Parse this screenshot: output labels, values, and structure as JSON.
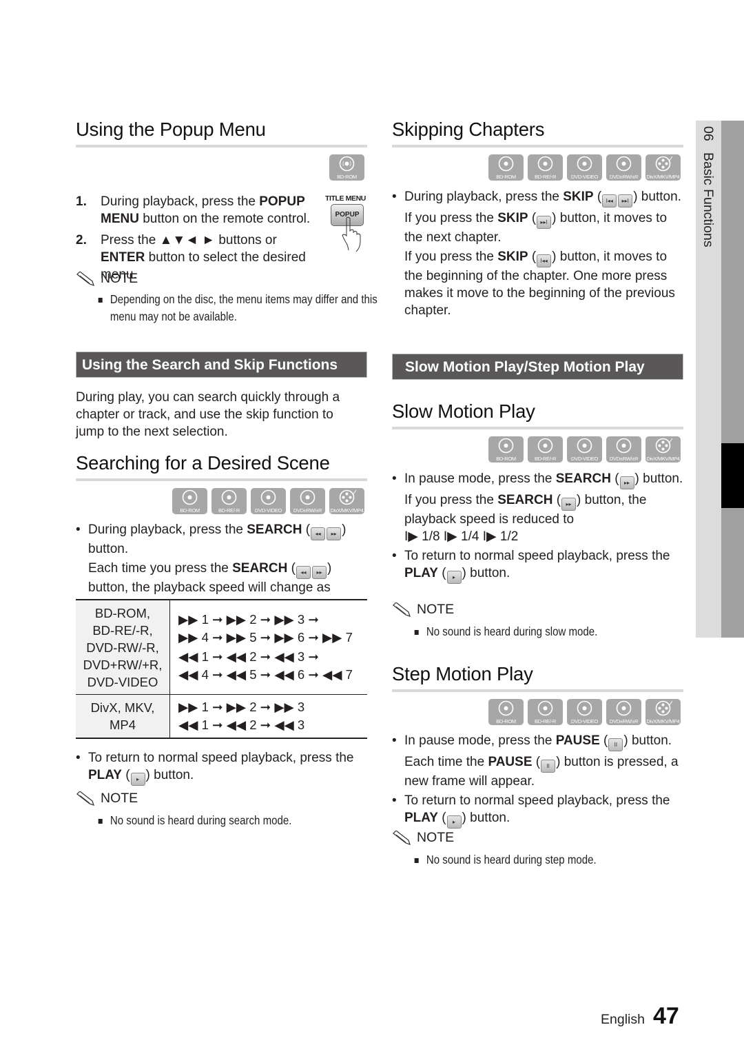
{
  "disc_badges": {
    "bd_rom": "BD-ROM",
    "bd_re": "BD-RE/-R",
    "dvd_video": "DVD-VIDEO",
    "dvd_rw": "DVD±RW/±R",
    "divx": "DivX/MKV/MP4"
  },
  "popup_menu": {
    "title": "Using the Popup Menu",
    "remote_label_top": "TITLE MENU",
    "remote_label_button": "POPUP",
    "steps": [
      {
        "num": "1.",
        "pre": "During playback, press the ",
        "bold": "POPUP MENU",
        "post": " button on the remote control."
      },
      {
        "num": "2.",
        "pre": "Press the ",
        "arrows": "▲▼◄ ►",
        "mid": " buttons or ",
        "bold": "ENTER",
        "post": " button to select the desired menu."
      }
    ],
    "note_label": "NOTE",
    "note_text": "Depending on the disc, the menu items may differ and this menu may not be available."
  },
  "search_skip": {
    "section_bar": "Using the Search and Skip Functions",
    "intro": "During play, you can search quickly through a chapter or track, and use the skip function to jump to the next selection."
  },
  "searching": {
    "title": "Searching for a Desired Scene",
    "bullet1_pre": "During playback, press the ",
    "bullet1_bold": "SEARCH",
    "bullet1_post": " button.",
    "sub_pre": "Each time you press the ",
    "sub_bold": "SEARCH",
    "sub_post": " button, the playback speed will change as follows.",
    "table": {
      "rows": [
        {
          "type_lines": [
            "BD-ROM,",
            "BD-RE/-R,",
            "DVD-RW/-R,",
            "DVD+RW/+R,",
            "DVD-VIDEO"
          ],
          "sequences": [
            "▶▶ 1 ➞ ▶▶ 2 ➞ ▶▶ 3 ➞",
            "▶▶ 4 ➞ ▶▶ 5 ➞ ▶▶ 6 ➞ ▶▶ 7",
            "◀◀ 1 ➞ ◀◀ 2 ➞ ◀◀ 3 ➞",
            "◀◀ 4 ➞ ◀◀ 5 ➞ ◀◀ 6 ➞ ◀◀ 7"
          ]
        },
        {
          "type_lines": [
            "DivX, MKV, MP4"
          ],
          "sequences": [
            "▶▶ 1 ➞ ▶▶ 2 ➞ ▶▶ 3",
            "◀◀ 1 ➞ ◀◀ 2 ➞ ◀◀ 3"
          ]
        }
      ]
    },
    "bullet2_pre": "To return to normal speed playback, press the ",
    "bullet2_bold": "PLAY",
    "bullet2_post": " button.",
    "note_label": "NOTE",
    "note_text": "No sound is heard during search mode."
  },
  "skipping": {
    "title": "Skipping Chapters",
    "bullet_pre": "During playback, press the ",
    "bullet_bold": "SKIP",
    "bullet_post": " button.",
    "next_pre": "If you press the ",
    "next_bold": "SKIP",
    "next_post": " button, it moves to the next chapter.",
    "prev_pre": "If you press the ",
    "prev_bold": "SKIP",
    "prev_post": " button, it moves to the beginning of the chapter. One more press makes it move to the beginning of the previous chapter."
  },
  "slow_step_bar": "Slow Motion Play/Step Motion Play",
  "slow_motion": {
    "title": "Slow Motion Play",
    "bullet1_pre": "In pause mode, press the ",
    "bullet1_bold": "SEARCH",
    "bullet1_post": " button.",
    "sub_pre": "If you press the ",
    "sub_bold": "SEARCH",
    "sub_post": " button, the playback speed is reduced to",
    "speeds": "I▶ 1/8 I▶ 1/4 I▶ 1/2",
    "bullet2_pre": "To return to normal speed playback, press the ",
    "bullet2_bold": "PLAY",
    "bullet2_post": " button.",
    "note_label": "NOTE",
    "note_text": "No sound is heard during slow mode."
  },
  "step_motion": {
    "title": "Step Motion Play",
    "bullet1_pre": "In pause mode, press the ",
    "bullet1_bold": "PAUSE",
    "bullet1_post": " button.",
    "sub_pre": "Each time the ",
    "sub_bold": "PAUSE",
    "sub_post": " button is pressed, a new frame will appear.",
    "bullet2_pre": "To return to normal speed playback, press the ",
    "bullet2_bold": "PLAY",
    "bullet2_post": " button.",
    "note_label": "NOTE",
    "note_text": "No sound is heard during step mode."
  },
  "side_tab": {
    "chapter_num": "06",
    "chapter_title": "Basic Functions"
  },
  "footer": {
    "language": "English",
    "page_number": "47"
  },
  "button_glyphs": {
    "rewind": "◂◂",
    "forward": "▸▸",
    "skip_prev": "I◂◂",
    "skip_next": "▸▸I",
    "play": "▸",
    "pause": "II"
  }
}
